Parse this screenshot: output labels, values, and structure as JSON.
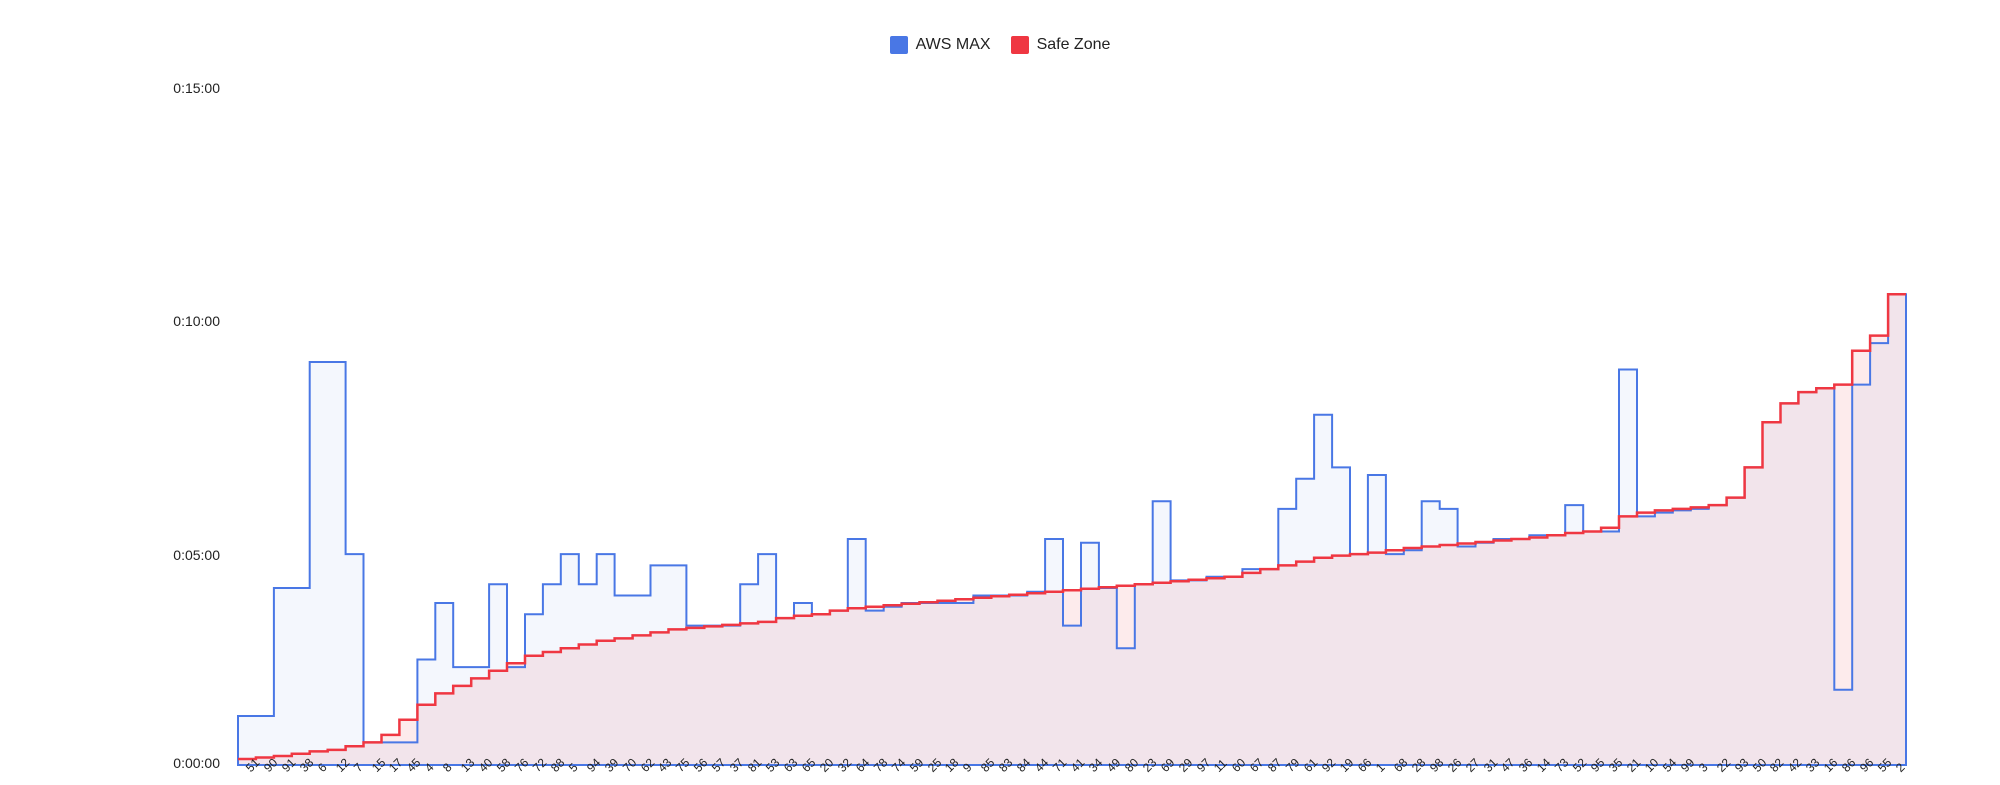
{
  "legend": {
    "series1": {
      "label": "AWS MAX",
      "color": "#4977e5"
    },
    "series2": {
      "label": "Safe Zone",
      "color": "#ef3742"
    }
  },
  "yaxis": {
    "ticks": [
      "0:00:00",
      "0:05:00",
      "0:10:00",
      "0:15:00"
    ],
    "max_seconds": 900
  },
  "chart_data": {
    "type": "line",
    "xlabel": "",
    "ylabel": "",
    "ylim": [
      0,
      900
    ],
    "y_tick_labels": [
      "0:00:00",
      "0:05:00",
      "0:10:00",
      "0:15:00"
    ],
    "categories": [
      "51",
      "90",
      "91",
      "38",
      "6",
      "12",
      "7",
      "15",
      "17",
      "45",
      "4",
      "8",
      "13",
      "40",
      "58",
      "76",
      "72",
      "88",
      "5",
      "94",
      "39",
      "70",
      "62",
      "43",
      "75",
      "56",
      "57",
      "37",
      "81",
      "53",
      "63",
      "65",
      "20",
      "32",
      "64",
      "78",
      "74",
      "59",
      "25",
      "18",
      "9",
      "85",
      "83",
      "84",
      "44",
      "71",
      "41",
      "34",
      "49",
      "80",
      "23",
      "69",
      "29",
      "97",
      "11",
      "60",
      "67",
      "87",
      "79",
      "61",
      "92",
      "19",
      "66",
      "1",
      "68",
      "28",
      "98",
      "26",
      "27",
      "31",
      "47",
      "36",
      "14",
      "73",
      "52",
      "95",
      "35",
      "21",
      "10",
      "54",
      "99",
      "3",
      "22",
      "93",
      "50",
      "82",
      "42",
      "33",
      "16",
      "86",
      "96",
      "55",
      "2"
    ],
    "series": [
      {
        "name": "AWS MAX",
        "color": "#4977e5",
        "values_seconds": [
          65,
          65,
          235,
          235,
          535,
          535,
          280,
          30,
          30,
          30,
          140,
          215,
          130,
          130,
          240,
          130,
          200,
          240,
          280,
          240,
          280,
          225,
          225,
          265,
          265,
          185,
          185,
          185,
          240,
          280,
          195,
          215,
          200,
          205,
          300,
          205,
          210,
          215,
          215,
          215,
          215,
          225,
          225,
          225,
          230,
          300,
          185,
          295,
          235,
          155,
          240,
          350,
          245,
          245,
          250,
          250,
          260,
          260,
          340,
          380,
          465,
          395,
          280,
          385,
          280,
          285,
          350,
          340,
          290,
          295,
          300,
          300,
          305,
          305,
          345,
          310,
          310,
          525,
          330,
          335,
          338,
          340,
          345,
          355,
          395,
          455,
          480,
          495,
          500,
          100,
          505,
          560,
          625
        ]
      },
      {
        "name": "Safe Zone",
        "color": "#ef3742",
        "values_seconds": [
          8,
          10,
          12,
          15,
          18,
          20,
          25,
          30,
          40,
          60,
          80,
          95,
          105,
          115,
          125,
          135,
          145,
          150,
          155,
          160,
          165,
          168,
          172,
          176,
          180,
          182,
          184,
          186,
          188,
          190,
          195,
          198,
          200,
          205,
          208,
          210,
          212,
          214,
          216,
          218,
          220,
          222,
          224,
          226,
          228,
          230,
          232,
          234,
          236,
          238,
          240,
          242,
          244,
          246,
          248,
          250,
          255,
          260,
          265,
          270,
          275,
          278,
          280,
          282,
          285,
          288,
          290,
          292,
          294,
          296,
          298,
          300,
          302,
          305,
          308,
          310,
          315,
          330,
          335,
          338,
          340,
          342,
          345,
          355,
          395,
          455,
          480,
          495,
          500,
          505,
          550,
          570,
          625
        ]
      }
    ]
  }
}
